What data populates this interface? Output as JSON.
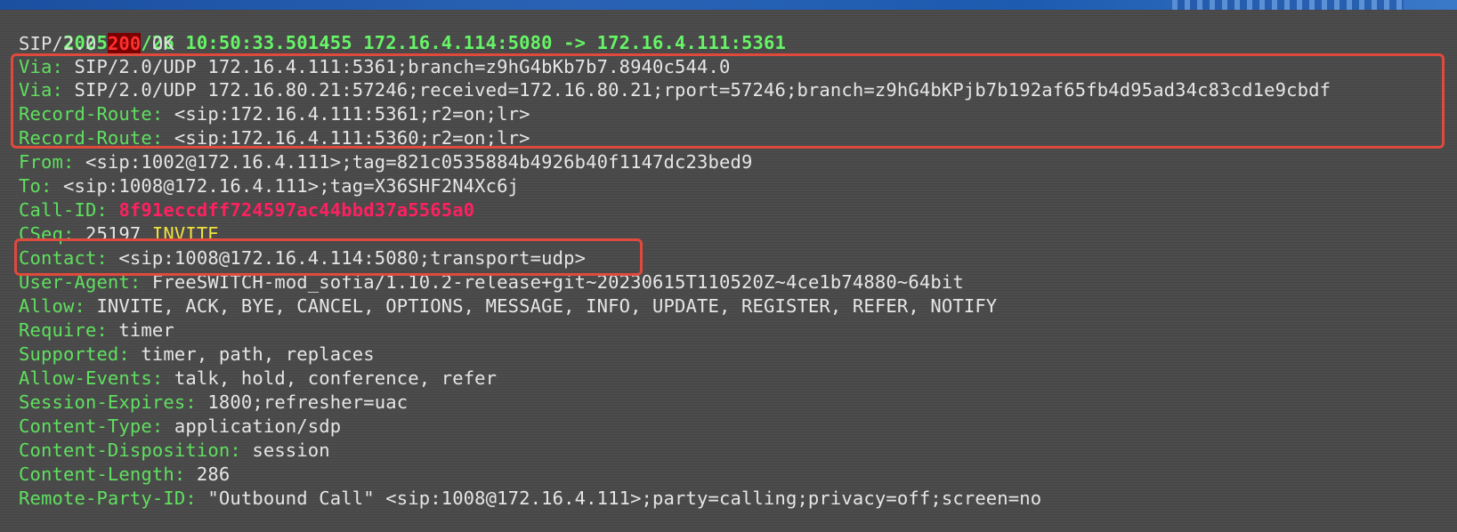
{
  "terminal": {
    "header": "2025/02/26 10:50:33.501455 172.16.4.114:5080 -> 172.16.4.111:5361",
    "status": {
      "protocol": "SIP/2.0 ",
      "code": "200",
      "reason": " OK"
    },
    "fields": [
      {
        "key": "Via:",
        "value": " SIP/2.0/UDP 172.16.4.111:5361;branch=z9hG4bKb7b7.8940c544.0"
      },
      {
        "key": "Via:",
        "value": " SIP/2.0/UDP 172.16.80.21:57246;received=172.16.80.21;rport=57246;branch=z9hG4bKPjb7b192af65fb4d95ad34c83cd1e9cbdf"
      },
      {
        "key": "Record-Route:",
        "value": " <sip:172.16.4.111:5361;r2=on;lr>"
      },
      {
        "key": "Record-Route:",
        "value": " <sip:172.16.4.111:5360;r2=on;lr>"
      },
      {
        "key": "From:",
        "value": " <sip:1002@172.16.4.111>;tag=821c0535884b4926b40f1147dc23bed9"
      },
      {
        "key": "To:",
        "value": " <sip:1008@172.16.4.111>;tag=X36SHF2N4Xc6j"
      },
      {
        "key": "Call-ID:",
        "value": " ",
        "special": "8f91eccdff724597ac44bbd37a5565a0"
      },
      {
        "key": "CSeq:",
        "value": " 25197 ",
        "method": "INVITE"
      },
      {
        "key": "Contact:",
        "value": " <sip:1008@172.16.4.114:5080;transport=udp>"
      },
      {
        "key": "User-Agent:",
        "value": " FreeSWITCH-mod_sofia/1.10.2-release+git~20230615T110520Z~4ce1b74880~64bit"
      },
      {
        "key": "Allow:",
        "value": " INVITE, ACK, BYE, CANCEL, OPTIONS, MESSAGE, INFO, UPDATE, REGISTER, REFER, NOTIFY"
      },
      {
        "key": "Require:",
        "value": " timer"
      },
      {
        "key": "Supported:",
        "value": " timer, path, replaces"
      },
      {
        "key": "Allow-Events:",
        "value": " talk, hold, conference, refer"
      },
      {
        "key": "Session-Expires:",
        "value": " 1800;refresher=uac"
      },
      {
        "key": "Content-Type:",
        "value": " application/sdp"
      },
      {
        "key": "Content-Disposition:",
        "value": " session"
      },
      {
        "key": "Content-Length:",
        "value": " 286"
      },
      {
        "key": "Remote-Party-ID:",
        "value": " \"Outbound Call\" <sip:1008@172.16.4.111>;party=calling;privacy=off;screen=no"
      }
    ]
  },
  "colors": {
    "terminal_bg": "#4c4c4c",
    "header_green": "#66f566",
    "key_green": "#5fe05f",
    "status_red": "#ff3030",
    "callid_pink": "#ff2060",
    "method_yellow": "#f0e040",
    "highlight_box": "#e04a3c"
  }
}
